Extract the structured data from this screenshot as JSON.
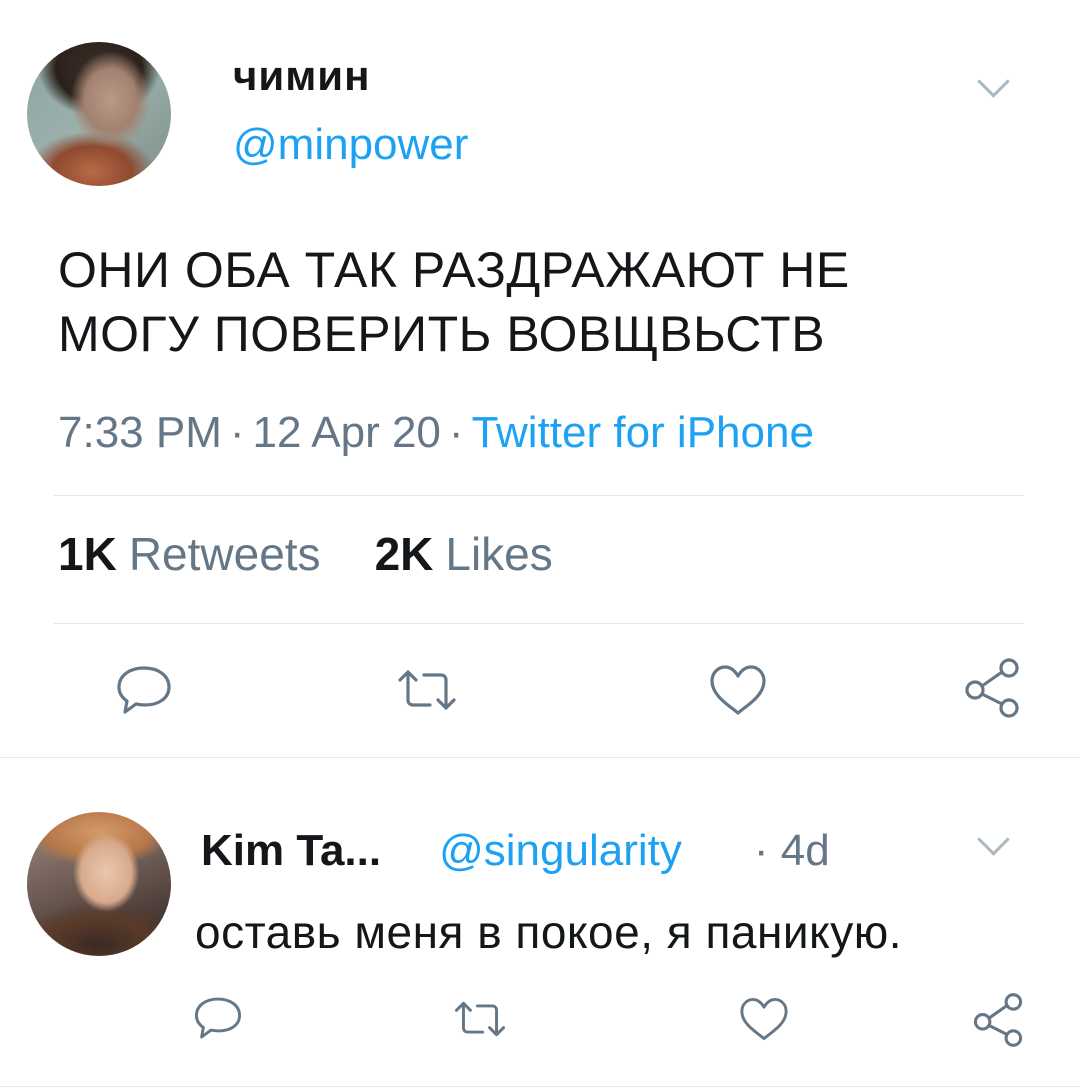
{
  "tweet": {
    "author_name": "чимин",
    "author_handle": "@minpower",
    "text_line1": "ОНИ ОБА ТАК РАЗДРАЖАЮТ НЕ",
    "text_line2": "МОГУ ПОВЕРИТЬ ВОВЩВЬСТВ",
    "time": "7:33 PM",
    "date": "12 Apr 20",
    "separator": "·",
    "source": "Twitter for iPhone",
    "retweets_count": "1K",
    "retweets_label": "Retweets",
    "likes_count": "2K",
    "likes_label": "Likes",
    "actions": [
      "reply",
      "retweet",
      "like",
      "share"
    ]
  },
  "reply": {
    "author_name": "Kim Ta...",
    "author_handle": "@singularity",
    "time": "· 4d",
    "text": "оставь меня в покое, я паникую.",
    "actions": [
      "reply",
      "retweet",
      "like",
      "share"
    ]
  },
  "colors": {
    "accent": "#1da1f2",
    "text": "#14171a",
    "secondary": "#657786",
    "icon": "#657786",
    "divider": "#e1e8ed"
  }
}
